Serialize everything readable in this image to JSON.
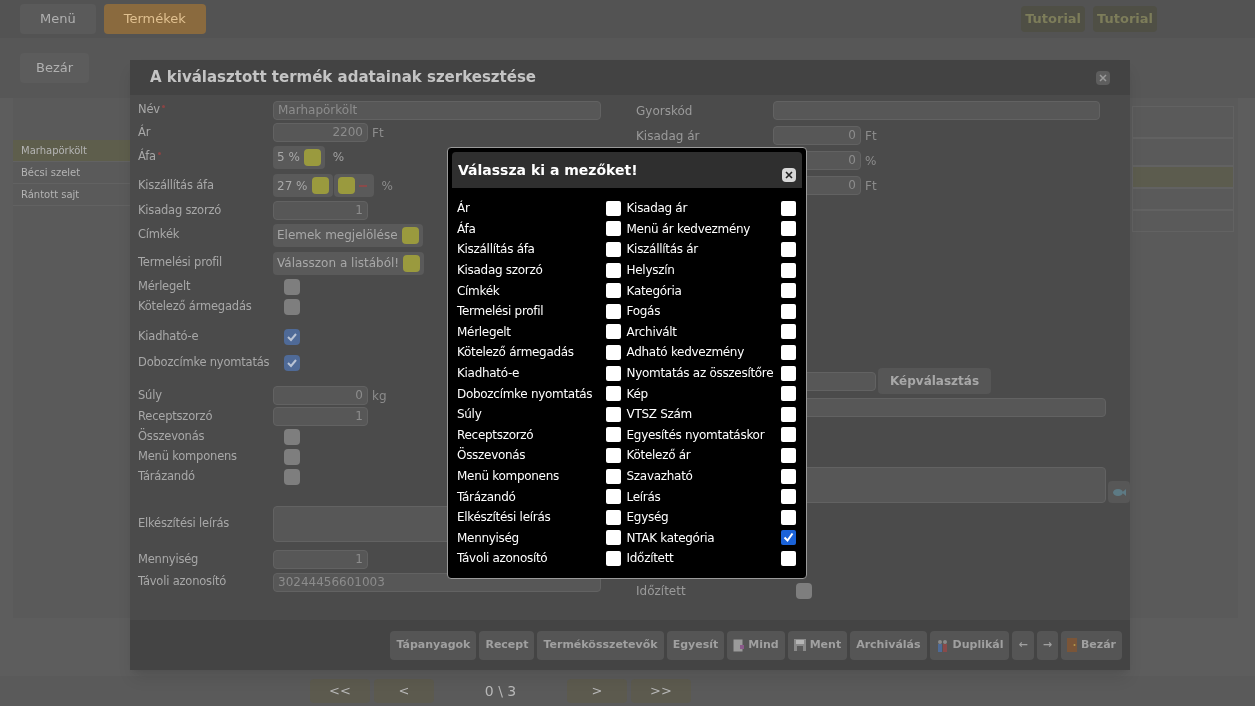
{
  "top_bar": {
    "buttons": [
      {
        "label": "Menü",
        "selected": false
      },
      {
        "label": "Termékek",
        "selected": true
      }
    ],
    "right_buttons": [
      "Tutorial",
      "Tutorial"
    ]
  },
  "sub_bar": {
    "button": "Bezár"
  },
  "product_list": {
    "items": [
      {
        "label": "Marhapörkölt",
        "selected": true
      },
      {
        "label": "Bécsi szelet",
        "selected": false
      },
      {
        "label": "Rántott sajt",
        "selected": false
      }
    ]
  },
  "pagination": {
    "first": "<<",
    "prev": "<",
    "page": "0 \\ 3",
    "next": ">",
    "last": ">>"
  },
  "dialog": {
    "title": "A kiválasztott termék adatainak szerkesztése",
    "left_fields": [
      {
        "kind": "text",
        "label": "Név",
        "required": true,
        "value": "Marhapörkölt"
      },
      {
        "kind": "number",
        "label": "Ár",
        "required": false,
        "value": "2200",
        "unit": "Ft"
      },
      {
        "kind": "select",
        "label": "Áfa",
        "required": true,
        "value": "5 %",
        "unit": "%"
      },
      {
        "kind": "select2",
        "label": "Kiszállítás áfa",
        "required": false,
        "value": "27 %",
        "unit": "%"
      },
      {
        "kind": "number",
        "label": "Kisadag szorzó",
        "required": false,
        "value": "1"
      },
      {
        "kind": "select",
        "label": "Címkék",
        "required": false,
        "value": "Elemek megjelölése"
      },
      {
        "kind": "select",
        "label": "Termelési profil",
        "required": false,
        "value": "Válasszon a listából!"
      },
      {
        "kind": "checkbox",
        "label": "Mérlegelt",
        "required": false,
        "checked": false
      },
      {
        "kind": "checkbox",
        "label": "Kötelező ármegadás",
        "required": false,
        "checked": false
      },
      {
        "kind": "checkbox",
        "label": "Kiadható-e",
        "required": false,
        "checked": true
      },
      {
        "kind": "checkbox",
        "label": "Dobozcímke nyomtatás",
        "required": false,
        "checked": true
      },
      {
        "kind": "number",
        "label": "Súly",
        "required": false,
        "value": "0",
        "unit": "kg"
      },
      {
        "kind": "number",
        "label": "Receptszorzó",
        "required": false,
        "value": "1"
      },
      {
        "kind": "checkbox",
        "label": "Összevonás",
        "required": false,
        "checked": false
      },
      {
        "kind": "checkbox",
        "label": "Menü komponens",
        "required": false,
        "checked": false
      },
      {
        "kind": "checkbox",
        "label": "Tárázandó",
        "required": false,
        "checked": false
      },
      {
        "kind": "textarea",
        "label": "Elkészítési leírás",
        "required": false
      },
      {
        "kind": "number",
        "label": "Mennyiség",
        "required": false,
        "value": "1"
      },
      {
        "kind": "text",
        "label": "Távoli azonosító",
        "required": false,
        "value": "30244456601003"
      }
    ],
    "right_fields": [
      {
        "label": "Gyorskód"
      },
      {
        "label": "Kisadag ár",
        "value": "0",
        "unit": "Ft"
      },
      {
        "value": "0",
        "unit": "%"
      },
      {
        "value": "0",
        "unit": "Ft"
      }
    ],
    "image_button": "Képválasztás",
    "scheduled": {
      "label": "Időzített",
      "checked": false
    },
    "buttons": [
      {
        "label": "Tápanyagok",
        "kind": "plain"
      },
      {
        "label": "Recept",
        "kind": "plain"
      },
      {
        "label": "Termékösszetevők",
        "kind": "plain"
      },
      {
        "label": "Egyesít",
        "kind": "plain"
      },
      {
        "label": "Mind",
        "kind": "page"
      },
      {
        "label": "Ment",
        "kind": "disk"
      },
      {
        "label": "Archiválás",
        "kind": "plain"
      },
      {
        "label": "Duplikál",
        "kind": "people"
      },
      {
        "label": "←",
        "kind": "plain"
      },
      {
        "label": "→",
        "kind": "plain"
      },
      {
        "label": "Bezár",
        "kind": "door"
      }
    ]
  },
  "field_picker": {
    "title": "Válassza ki a mezőket!",
    "columns": [
      [
        {
          "label": "Ár",
          "checked": false
        },
        {
          "label": "Áfa",
          "checked": false
        },
        {
          "label": "Kiszállítás áfa",
          "checked": false
        },
        {
          "label": "Kisadag szorzó",
          "checked": false
        },
        {
          "label": "Címkék",
          "checked": false
        },
        {
          "label": "Termelési profil",
          "checked": false
        },
        {
          "label": "Mérlegelt",
          "checked": false
        },
        {
          "label": "Kötelező ármegadás",
          "checked": false
        },
        {
          "label": "Kiadható-e",
          "checked": false
        },
        {
          "label": "Dobozcímke nyomtatás",
          "checked": false
        },
        {
          "label": "Súly",
          "checked": false
        },
        {
          "label": "Receptszorzó",
          "checked": false
        },
        {
          "label": "Összevonás",
          "checked": false
        },
        {
          "label": "Menü komponens",
          "checked": false
        },
        {
          "label": "Tárázandó",
          "checked": false
        },
        {
          "label": "Elkészítési leírás",
          "checked": false
        },
        {
          "label": "Mennyiség",
          "checked": false
        },
        {
          "label": "Távoli azonosító",
          "checked": false
        }
      ],
      [
        {
          "label": "Kisadag ár",
          "checked": false
        },
        {
          "label": "Menü ár kedvezmény",
          "checked": false
        },
        {
          "label": "Kiszállítás ár",
          "checked": false
        },
        {
          "label": "Helyszín",
          "checked": false
        },
        {
          "label": "Kategória",
          "checked": false
        },
        {
          "label": "Fogás",
          "checked": false
        },
        {
          "label": "Archivált",
          "checked": false
        },
        {
          "label": "Adható kedvezmény",
          "checked": false
        },
        {
          "label": "Nyomtatás az összesítőre",
          "checked": false
        },
        {
          "label": "Kép",
          "checked": false
        },
        {
          "label": "VTSZ Szám",
          "checked": false
        },
        {
          "label": "Egyesítés nyomtatáskor",
          "checked": false
        },
        {
          "label": "Kötelező ár",
          "checked": false
        },
        {
          "label": "Szavazható",
          "checked": false
        },
        {
          "label": "Leírás",
          "checked": false
        },
        {
          "label": "Egység",
          "checked": false
        },
        {
          "label": "NTAK kategória",
          "checked": true
        },
        {
          "label": "Időzített",
          "checked": false
        }
      ]
    ]
  }
}
